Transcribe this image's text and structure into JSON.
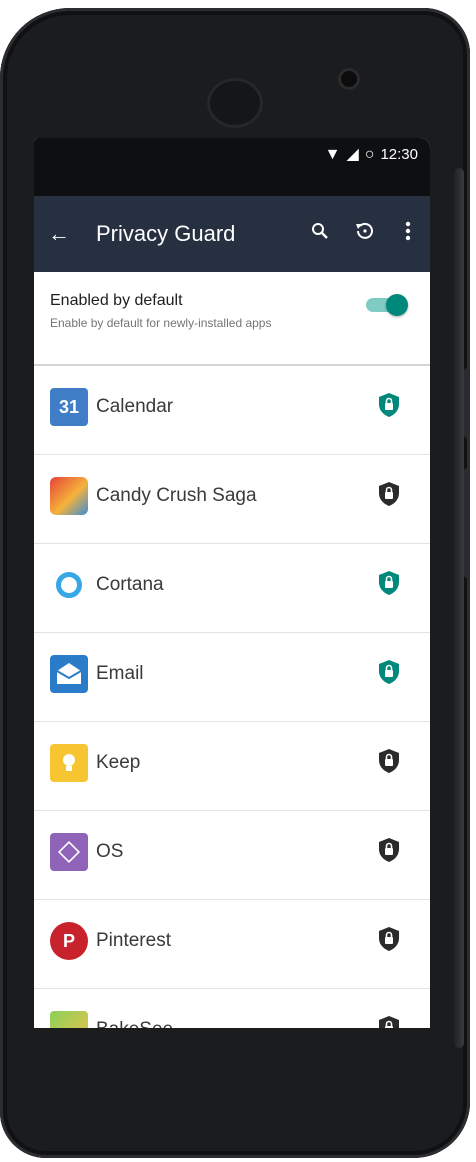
{
  "status_bar": {
    "time": "12:30",
    "wifi_icon": "wifi-icon",
    "signal_icon": "signal-icon",
    "battery_icon": "battery-icon"
  },
  "toolbar": {
    "back_icon": "back-arrow-icon",
    "title": "Privacy Guard",
    "actions": [
      "search-icon",
      "restore-icon",
      "more-vert-icon"
    ]
  },
  "default_setting": {
    "title": "Enabled by default",
    "subtitle": "Enable by default for newly-installed apps",
    "enabled": true
  },
  "colors": {
    "toolbar": "#263040",
    "accent": "#00897b",
    "shield_on": "#00897b",
    "shield_off": "#2b2b2b"
  },
  "apps": [
    {
      "name": "Calendar",
      "icon": "calendar-icon",
      "icon_text": "31",
      "guarded": true
    },
    {
      "name": "Candy Crush Saga",
      "icon": "candy-crush-icon",
      "icon_text": "",
      "guarded": false
    },
    {
      "name": "Cortana",
      "icon": "cortana-icon",
      "icon_text": "",
      "guarded": true
    },
    {
      "name": "Email",
      "icon": "email-icon",
      "icon_text": "",
      "guarded": true
    },
    {
      "name": "Keep",
      "icon": "keep-icon",
      "icon_text": "",
      "guarded": false
    },
    {
      "name": "OS",
      "icon": "os-icon",
      "icon_text": "",
      "guarded": false
    },
    {
      "name": "Pinterest",
      "icon": "pinterest-icon",
      "icon_text": "P",
      "guarded": false
    },
    {
      "name": "BakeSee",
      "icon": "bakery-icon",
      "icon_text": "",
      "guarded": false
    }
  ]
}
